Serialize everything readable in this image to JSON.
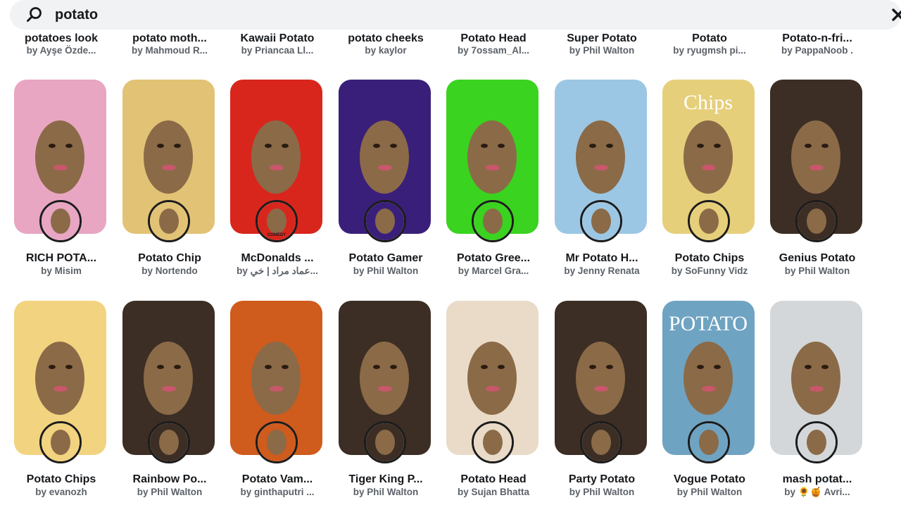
{
  "search": {
    "query": "potato",
    "icon": "search-icon",
    "close_icon": "close-icon"
  },
  "top_row": [
    {
      "name": "potatoes look",
      "author": "by Ayşe Özde..."
    },
    {
      "name": "potato moth...",
      "author": "by Mahmoud R..."
    },
    {
      "name": "Kawaii Potato",
      "author": "by Priancaa Ll..."
    },
    {
      "name": "potato cheeks",
      "author": "by kaylor"
    },
    {
      "name": "Potato Head",
      "author": "by 7ossam_Al..."
    },
    {
      "name": "Super Potato",
      "author": "by Phil Walton"
    },
    {
      "name": "Potato",
      "author": "by ryugmsh pi..."
    },
    {
      "name": "Potato-n-fri...",
      "author": "by PappaNoob ."
    }
  ],
  "row1": [
    {
      "name": "RICH POTA...",
      "author": "by Misim",
      "bg": "#e8a6c3"
    },
    {
      "name": "Potato Chip",
      "author": "by Nortendo",
      "bg": "#e2c274"
    },
    {
      "name": "McDonalds ...",
      "author": "by عماد مراد | خي...",
      "bg": "#d8261d",
      "badge_text": "COMEDY"
    },
    {
      "name": "Potato Gamer",
      "author": "by Phil Walton",
      "bg": "#3a1f7a"
    },
    {
      "name": "Potato Gree...",
      "author": "by Marcel Gra...",
      "bg": "#3ad31f"
    },
    {
      "name": "Mr Potato H...",
      "author": "by Jenny Renata",
      "bg": "#9cc7e4"
    },
    {
      "name": "Potato Chips",
      "author": "by SoFunny Vidz",
      "bg": "#e6cf7a",
      "thumb_text": "Chips"
    },
    {
      "name": "Genius Potato",
      "author": "by Phil Walton",
      "bg": "#3c2e24"
    }
  ],
  "row2": [
    {
      "name": "Potato Chips",
      "author": "by evanozh",
      "bg": "#f2d37f"
    },
    {
      "name": "Rainbow Po...",
      "author": "by Phil Walton",
      "bg": "#3c2e24"
    },
    {
      "name": "Potato Vam...",
      "author": "by ginthaputri ...",
      "bg": "#cf5b1d"
    },
    {
      "name": "Tiger King P...",
      "author": "by Phil Walton",
      "bg": "#3c2e24"
    },
    {
      "name": "Potato Head",
      "author": "by Sujan Bhatta",
      "bg": "#e9dbc8"
    },
    {
      "name": "Party Potato",
      "author": "by Phil Walton",
      "bg": "#3c2e24"
    },
    {
      "name": "Vogue Potato",
      "author": "by Phil Walton",
      "bg": "#6fa3c2",
      "thumb_text": "POTATO"
    },
    {
      "name": "mash potat...",
      "author": "by 🌻🍯 Avri...",
      "bg": "#d4d7da"
    }
  ]
}
